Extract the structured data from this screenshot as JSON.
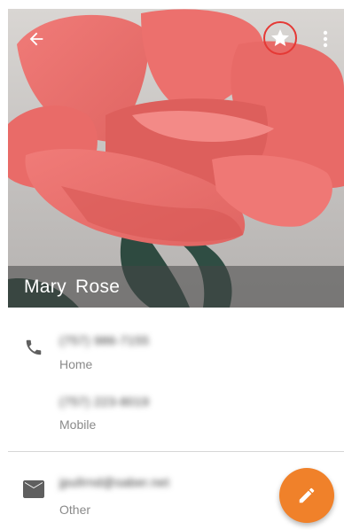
{
  "contact": {
    "name": "Mary  Rose"
  },
  "toolbar": {
    "back_icon": "arrow-back-icon",
    "star_icon": "star-icon",
    "more_icon": "more-vert-icon"
  },
  "phones": [
    {
      "number": "(757) 986-7155",
      "type": "Home",
      "icon": "phone-icon"
    },
    {
      "number": "(757) 223-8019",
      "type": "Mobile"
    }
  ],
  "emails": [
    {
      "address": "jpullrnd@saber.net",
      "type": "Other",
      "icon": "email-icon"
    }
  ],
  "fab": {
    "icon": "edit-pencil-icon",
    "color": "#f0812a"
  },
  "colors": {
    "favorite_ring": "#e53935",
    "name_bar": "#464646",
    "label": "#8a8a8a"
  }
}
